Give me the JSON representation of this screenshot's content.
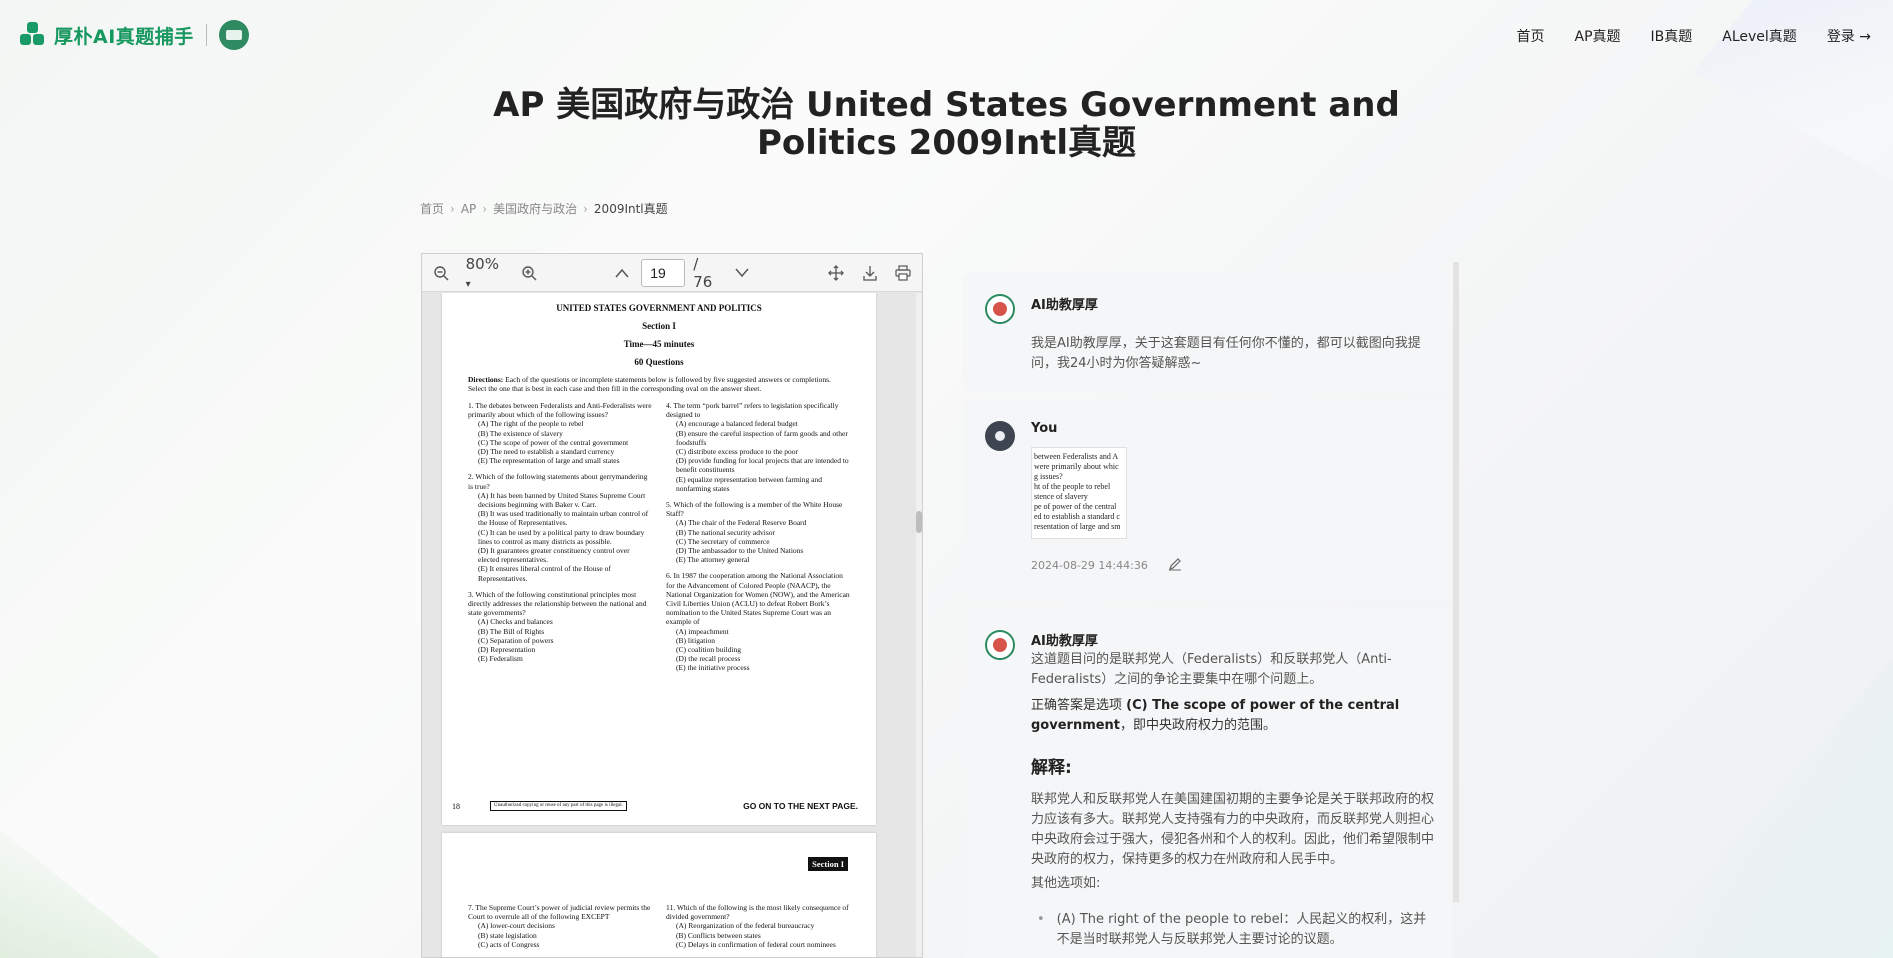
{
  "brand": {
    "name": "厚朴AI真题捕手",
    "accent": "#16985f"
  },
  "nav": {
    "items": [
      "首页",
      "AP真题",
      "IB真题",
      "ALevel真题"
    ],
    "login": "登录 →"
  },
  "title": {
    "line1": "AP 美国政府与政治 United States Government and",
    "line2": "Politics 2009Intl真题"
  },
  "breadcrumb": [
    "首页",
    "AP",
    "美国政府与政治",
    "2009Intl真题"
  ],
  "viewer": {
    "zoom": "80%",
    "page": "19",
    "total": "/ 76",
    "doc": {
      "header": "UNITED STATES GOVERNMENT AND POLITICS",
      "section": "Section I",
      "time": "Time—45 minutes",
      "count": "60 Questions",
      "directions_label": "Directions:",
      "directions": "Each of the questions or incomplete statements below is followed by five suggested answers or completions. Select the one that is best in each case and then fill in the corresponding oval on the answer sheet.",
      "left": [
        {
          "q": "1.  The debates between Federalists and Anti-Federalists were primarily about which of the following issues?",
          "opts": [
            "(A) The right of the people to rebel",
            "(B) The existence of slavery",
            "(C) The scope of power of the central government",
            "(D) The need to establish a standard currency",
            "(E) The representation of large and small states"
          ]
        },
        {
          "q": "2.  Which of the following statements about gerrymandering is true?",
          "opts": [
            "(A) It has been banned by United States Supreme Court decisions beginning with Baker v. Carr.",
            "(B) It was used traditionally to maintain urban control of the House of Representatives.",
            "(C) It can be used by a political party to draw boundary lines to control as many districts as possible.",
            "(D) It guarantees greater constituency control over elected representatives.",
            "(E) It ensures liberal control of the House of Representatives."
          ]
        },
        {
          "q": "3.  Which of the following constitutional principles most directly addresses the relationship between the national and state governments?",
          "opts": [
            "(A) Checks and balances",
            "(B) The Bill of Rights",
            "(C) Separation of powers",
            "(D) Representation",
            "(E) Federalism"
          ]
        }
      ],
      "right": [
        {
          "q": "4.  The term “pork barrel” refers to legislation specifically designed to",
          "opts": [
            "(A) encourage a balanced federal budget",
            "(B) ensure the careful inspection of farm goods and other foodstuffs",
            "(C) distribute excess produce to the poor",
            "(D) provide funding for local projects that are intended to benefit constituents",
            "(E) equalize representation between farming and nonfarming states"
          ]
        },
        {
          "q": "5.  Which of the following is a member of the White House Staff?",
          "opts": [
            "(A) The chair of the Federal Reserve Board",
            "(B) The national security advisor",
            "(C) The secretary of commerce",
            "(D) The ambassador to the United Nations",
            "(E) The attorney general"
          ]
        },
        {
          "q": "6.  In 1987 the cooperation among the National Association for the Advancement of Colored People (NAACP), the National Organization for Women (NOW), and the American Civil Liberties Union (ACLU) to defeat Robert Bork’s nomination to the United States Supreme Court was an example of",
          "opts": [
            "(A) impeachment",
            "(B) litigation",
            "(C) coalition building",
            "(D) the recall process",
            "(E) the initiative process"
          ]
        }
      ],
      "page_no": "18",
      "copy_note": "Unauthorized copying or reuse of any part of this page is illegal.",
      "next": "GO ON TO THE NEXT PAGE.",
      "p2_tag": "Section I",
      "p2_left": [
        "7.  The Supreme Court’s power of judicial review permits the Court to overrule all of the following EXCEPT",
        "(A) lower-court decisions",
        "(B) state legislation",
        "(C) acts of Congress"
      ],
      "p2_right": [
        "11. Which of the following is the most likely consequence of divided government?",
        "(A) Reorganization of the federal bureaucracy",
        "(B) Conflicts between states",
        "(C) Delays in confirmation of federal court nominees"
      ]
    }
  },
  "chat": {
    "ai_name": "AI助教厚厚",
    "greeting": "我是AI助教厚厚，关于这套题目有任何你不懂的，都可以截图向我提问，我24小时为你答疑解惑~",
    "user_name": "You",
    "thumb_lines": [
      "between Federalists and A",
      "were primarily about whic",
      "g issues?",
      "ht of the people to rebel",
      "stence of slavery",
      "pe of power of the central",
      "ed to establish a standard c",
      "resentation of large and sm"
    ],
    "timestamp": "2024-08-29 14:44:36",
    "answer_intro": "这道题目问的是联邦党人（Federalists）和反联邦党人（Anti-Federalists）之间的争论主要集中在哪个问题上。",
    "answer_prefix": "正确答案是选项",
    "answer_bold": "(C) The scope of power of the central government",
    "answer_suffix": "，即中央政府权力的范围。",
    "explain_heading": "解释:",
    "explain_body": "联邦党人和反联邦党人在美国建国初期的主要争论是关于联邦政府的权力应该有多大。联邦党人支持强有力的中央政府，而反联邦党人则担心中央政府会过于强大，侵犯各州和个人的权利。因此，他们希望限制中央政府的权力，保持更多的权力在州政府和人民手中。",
    "others_label": "其他选项如:",
    "option_a": "(A) The right of the people to rebel：人民起义的权利，这并不是当时联邦党人与反联邦党人主要讨论的议题。"
  }
}
